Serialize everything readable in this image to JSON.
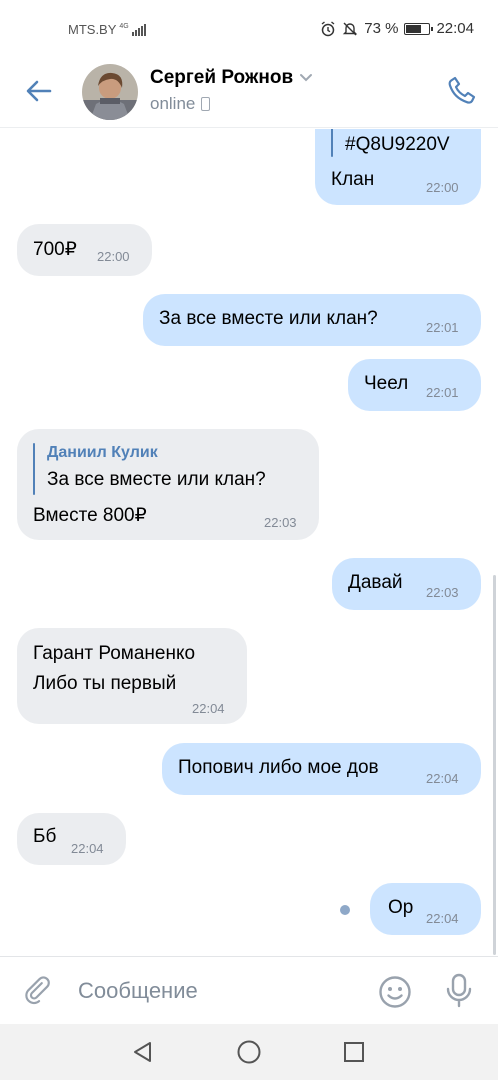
{
  "status_bar": {
    "carrier": "MTS.BY",
    "network": "4G",
    "battery": "73 %",
    "battery_level": 0.73,
    "time": "22:04"
  },
  "header": {
    "contact_name": "Сергей Рожнов",
    "status": "online",
    "back_icon": "arrow-left-icon",
    "call_icon": "phone-icon"
  },
  "messages": [
    {
      "dir": "out",
      "reply_code": "#Q8U9220V",
      "text": "Клан",
      "time": "22:00"
    },
    {
      "dir": "in",
      "text": "700₽",
      "time": "22:00"
    },
    {
      "dir": "out",
      "text": "За все вместе или клан?",
      "time": "22:01"
    },
    {
      "dir": "out",
      "text": "Чеел",
      "time": "22:01"
    },
    {
      "dir": "in",
      "reply_author": "Даниил Кулик",
      "reply_text": "За все вместе или клан?",
      "text": "Вместе 800₽",
      "time": "22:03"
    },
    {
      "dir": "out",
      "text": "Давай",
      "time": "22:03"
    },
    {
      "dir": "in",
      "line1": "Гарант Романенко",
      "line2": "Либо ты первый",
      "time": "22:04"
    },
    {
      "dir": "out",
      "text": "Попович либо мое дов",
      "time": "22:04"
    },
    {
      "dir": "in",
      "text": "Бб",
      "time": "22:04"
    },
    {
      "dir": "out",
      "text": "Ор",
      "time": "22:04",
      "unread": true
    }
  ],
  "composer": {
    "placeholder": "Сообщение",
    "attach_icon": "paperclip-icon",
    "emoji_icon": "smiley-icon",
    "mic_icon": "microphone-icon"
  },
  "colors": {
    "accent": "#5181b8",
    "incoming_bubble": "#ebedf0",
    "outgoing_bubble": "#cce4ff",
    "secondary_text": "#818c99"
  }
}
